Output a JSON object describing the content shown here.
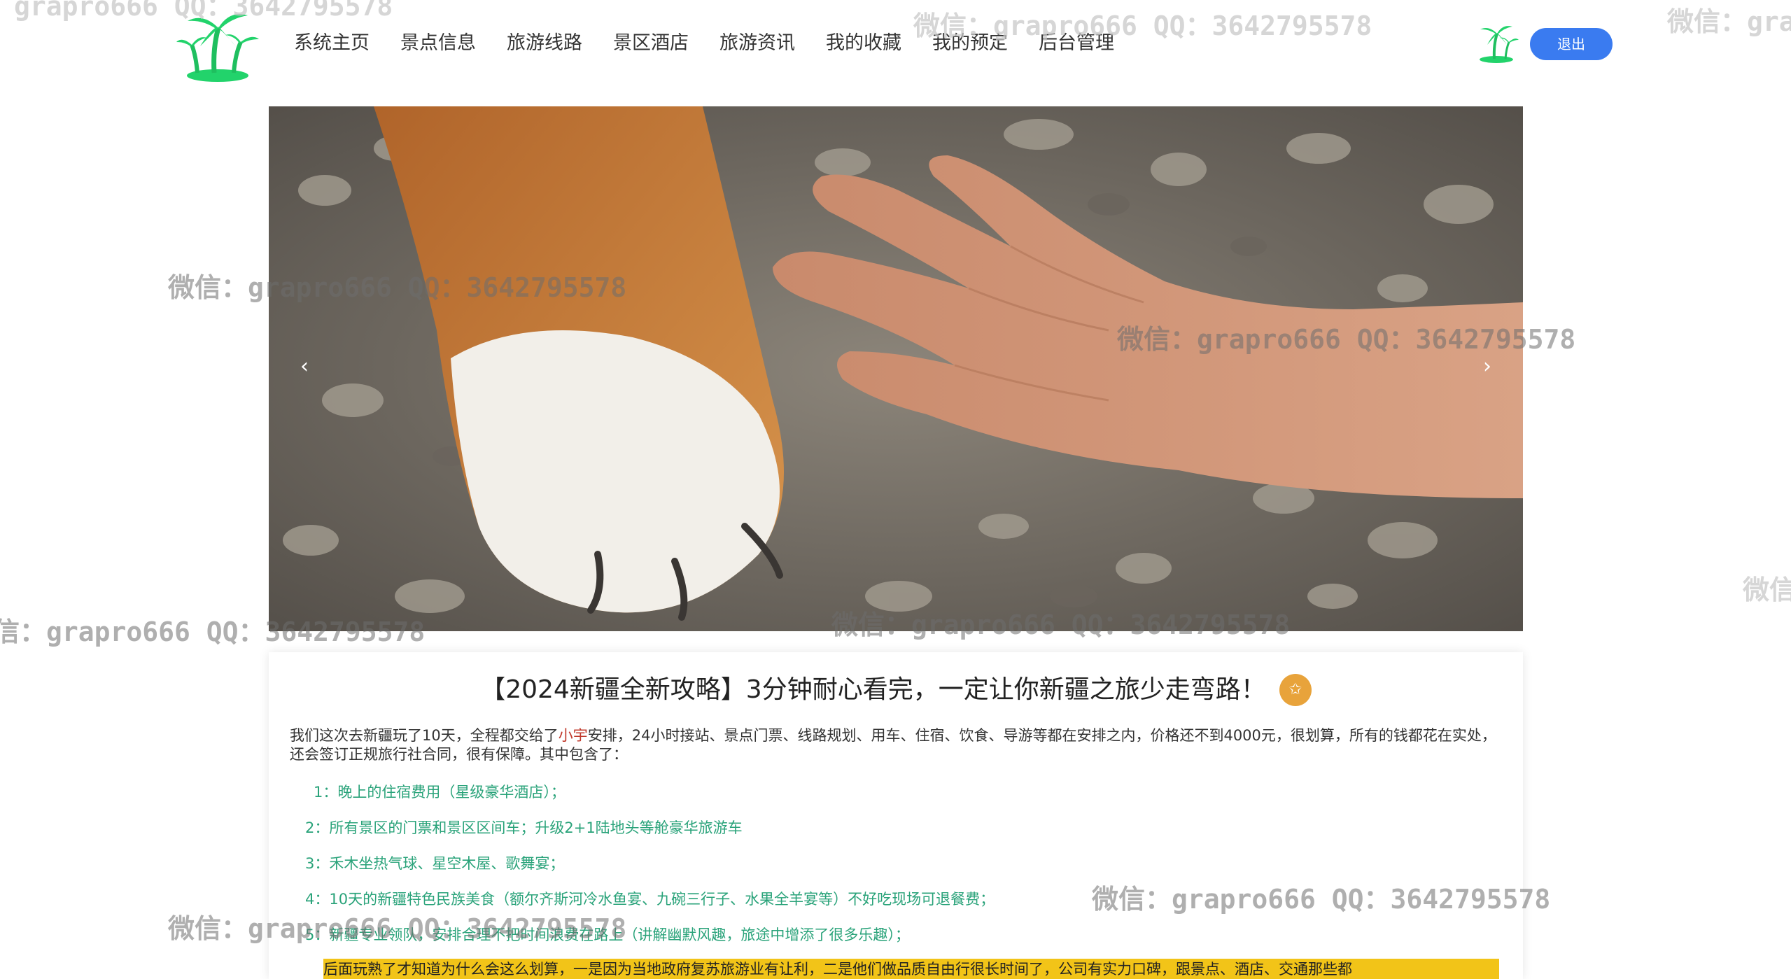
{
  "header": {
    "nav": [
      "系统主页",
      "景点信息",
      "旅游线路",
      "景区酒店",
      "旅游资讯",
      "我的收藏",
      "我的预定",
      "后台管理"
    ],
    "logout_label": "退出"
  },
  "carousel": {
    "prev_label": "‹",
    "next_label": "›"
  },
  "article": {
    "title": "【2024新疆全新攻略】3分钟耐心看完，一定让你新疆之旅少走弯路！",
    "fav_icon_label": "✩",
    "intro_part1": "我们这次去新疆玩了10天，全程都交给了",
    "intro_highlight": "小宇",
    "intro_part2": "安排，24小时接站、景点门票、线路规划、用车、住宿、饮食、导游等都在安排之内，价格还不到4000元，很划算，所有的钱都花在实处，还会签订正规旅行社合同，很有保障。其中包含了：",
    "items": [
      "1：晚上的住宿费用（星级豪华酒店）；",
      "2：所有景区的门票和景区区间车；升级2+1陆地头等舱豪华旅游车",
      "3：禾木坐热气球、星空木屋、歌舞宴；",
      "4：10天的新疆特色民族美食（额尔齐斯河冷水鱼宴、九碗三行子、水果全羊宴等）不好吃现场可退餐费；",
      "5：新疆专业领队，安排合理不把时间浪费在路上（讲解幽默风趣，旅途中增添了很多乐趣）；"
    ],
    "highlight_paragraph": "后面玩熟了才知道为什么会这么划算，一是因为当地政府复苏旅游业有让利，二是他们做品质自由行很长时间了，公司有实力口碑，跟景点、酒店、交通那些都"
  },
  "watermark": {
    "text": "微信：grapro666 QQ：3642795578",
    "partial_right_top": "微信：gra",
    "partial_right_mid": "微信",
    "partial_top_left": "grapro666 QQ：3642795578",
    "partial_left_mid": "信：grapro666 QQ：3642795578"
  },
  "colors": {
    "logo_green": "#22d36b",
    "logout_blue": "#3a7bf0",
    "fav_orange": "#e8a33b",
    "list_green": "#2aa37a",
    "highlight_yellow": "#f2c418",
    "highlight_red": "#c0392b"
  }
}
